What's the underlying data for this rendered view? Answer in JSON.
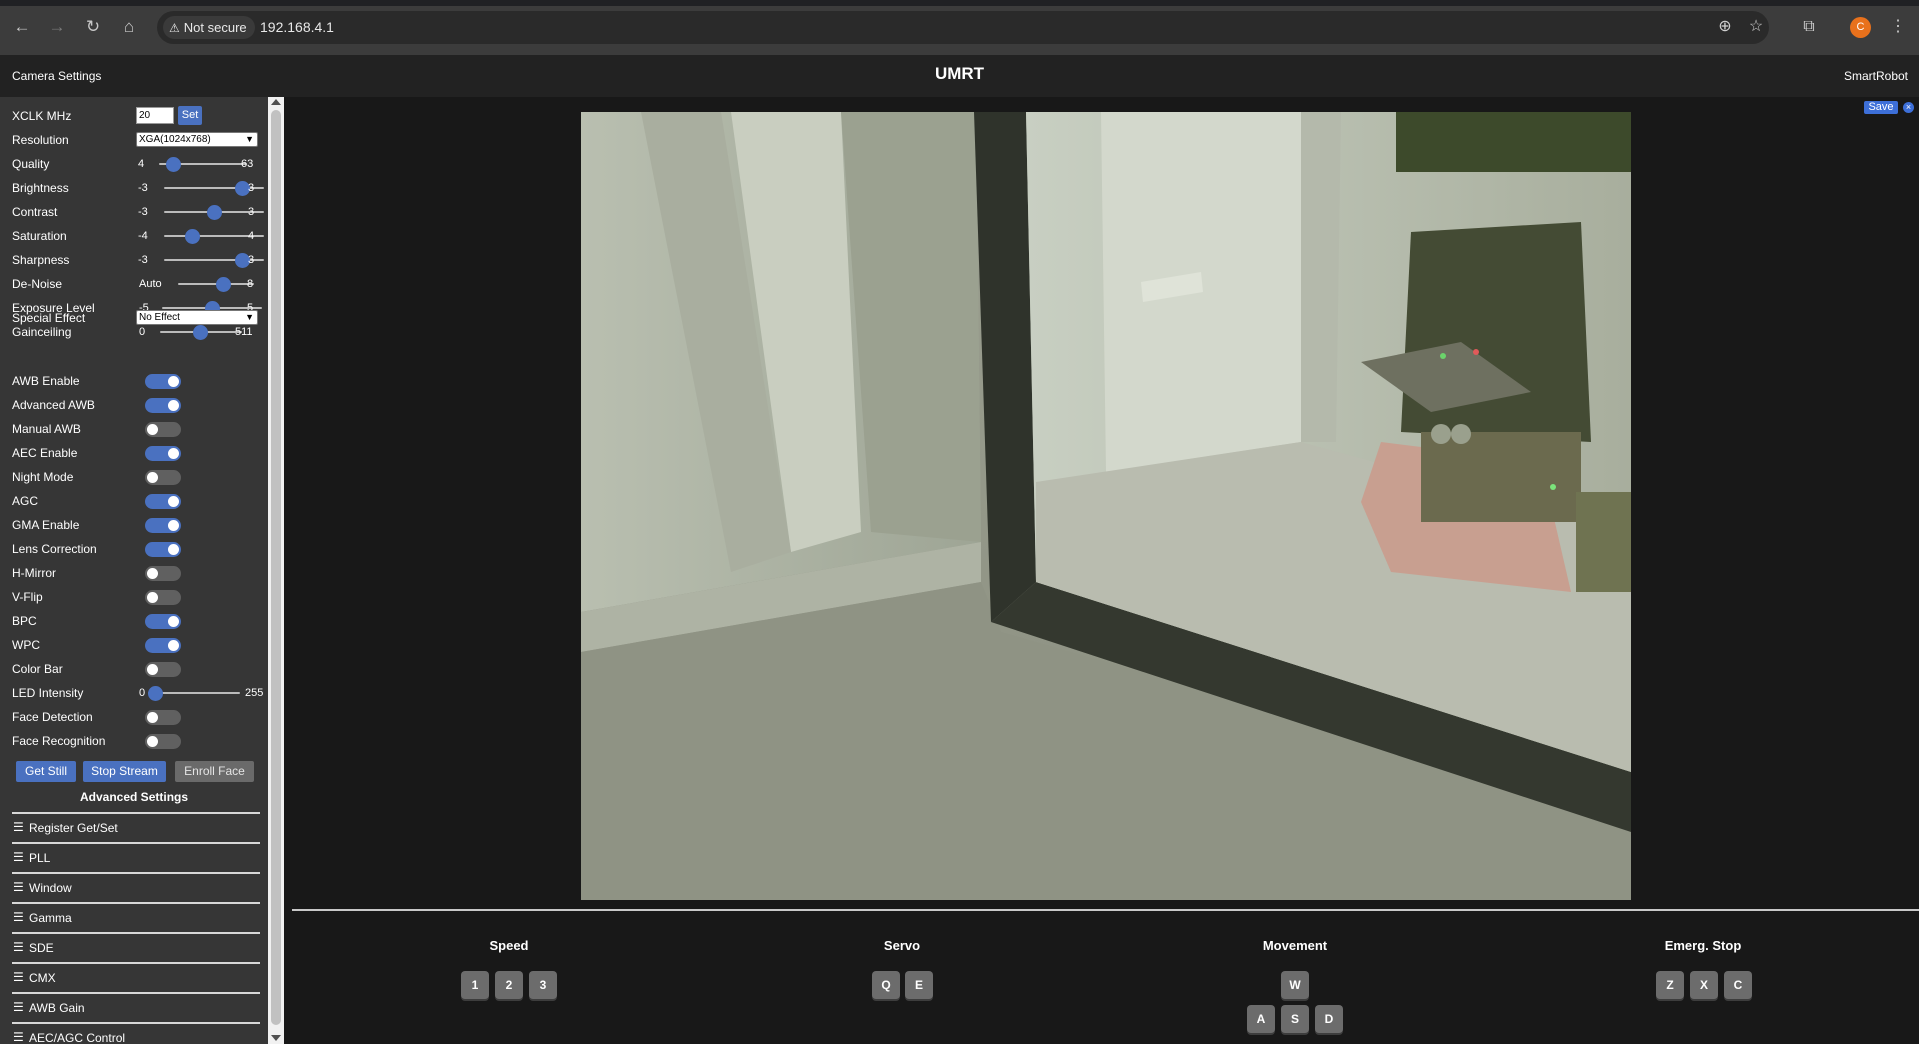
{
  "browser": {
    "security_label": "Not secure",
    "url": "192.168.4.1",
    "profile_initial": "C"
  },
  "header": {
    "left": "Camera Settings",
    "title": "UMRT",
    "right": "SmartRobot"
  },
  "sidebar": {
    "xclk": {
      "label": "XCLK MHz",
      "value": "20",
      "set_label": "Set"
    },
    "resolution": {
      "label": "Resolution",
      "value": "XGA(1024x768)"
    },
    "sliders": [
      {
        "label": "Quality",
        "min": "4",
        "max": "63",
        "value": 10,
        "min_value": 4,
        "max_value": 63
      },
      {
        "label": "Brightness",
        "min": "-3",
        "max": "3",
        "value": 2,
        "min_value": -3,
        "max_value": 3
      },
      {
        "label": "Contrast",
        "min": "-3",
        "max": "3",
        "value": 0,
        "min_value": -3,
        "max_value": 3
      },
      {
        "label": "Saturation",
        "min": "-4",
        "max": "4",
        "value": -2,
        "min_value": -4,
        "max_value": 4
      },
      {
        "label": "Sharpness",
        "min": "-3",
        "max": "3",
        "value": 2,
        "min_value": -3,
        "max_value": 3
      },
      {
        "label": "De-Noise",
        "min": "Auto",
        "max": "8",
        "value": 5,
        "min_value": 0,
        "max_value": 8
      },
      {
        "label": "Exposure Level",
        "min": "-5",
        "max": "5",
        "value": 0,
        "min_value": -5,
        "max_value": 5
      },
      {
        "label": "Gainceiling",
        "min": "0",
        "max": "511",
        "value": 255,
        "min_value": 0,
        "max_value": 511
      }
    ],
    "special_effect": {
      "label": "Special Effect",
      "value": "No Effect"
    },
    "toggles": [
      {
        "label": "AWB Enable",
        "on": true
      },
      {
        "label": "Advanced AWB",
        "on": true
      },
      {
        "label": "Manual AWB",
        "on": false
      },
      {
        "label": "AEC Enable",
        "on": true
      },
      {
        "label": "Night Mode",
        "on": false
      },
      {
        "label": "AGC",
        "on": true
      },
      {
        "label": "GMA Enable",
        "on": true
      },
      {
        "label": "Lens Correction",
        "on": true
      },
      {
        "label": "H-Mirror",
        "on": false
      },
      {
        "label": "V-Flip",
        "on": false
      },
      {
        "label": "BPC",
        "on": true
      },
      {
        "label": "WPC",
        "on": true
      },
      {
        "label": "Color Bar",
        "on": false
      }
    ],
    "led": {
      "label": "LED Intensity",
      "min": "0",
      "max": "255",
      "value": 0,
      "min_value": 0,
      "max_value": 255
    },
    "face_toggles": [
      {
        "label": "Face Detection",
        "on": false
      },
      {
        "label": "Face Recognition",
        "on": false
      }
    ],
    "buttons": {
      "get_still": "Get Still",
      "stop_stream": "Stop Stream",
      "enroll_face": "Enroll Face"
    },
    "advanced_title": "Advanced Settings",
    "sections": [
      "Register Get/Set",
      "PLL",
      "Window",
      "Gamma",
      "SDE",
      "CMX",
      "AWB Gain",
      "AEC/AGC Control"
    ]
  },
  "main": {
    "save_label": "Save",
    "close_label": "×"
  },
  "controls": {
    "speed": {
      "title": "Speed",
      "keys": [
        "1",
        "2",
        "3"
      ]
    },
    "servo": {
      "title": "Servo",
      "keys": [
        "Q",
        "E"
      ]
    },
    "movement": {
      "title": "Movement",
      "keys": [
        "W",
        "A",
        "S",
        "D"
      ]
    },
    "stop": {
      "title": "Emerg. Stop",
      "keys": [
        "Z",
        "X",
        "C"
      ]
    }
  },
  "colors": {
    "accent": "#4a71c0",
    "header_bg": "#222222",
    "sidebar_bg": "#363636",
    "page_bg": "#181818"
  }
}
